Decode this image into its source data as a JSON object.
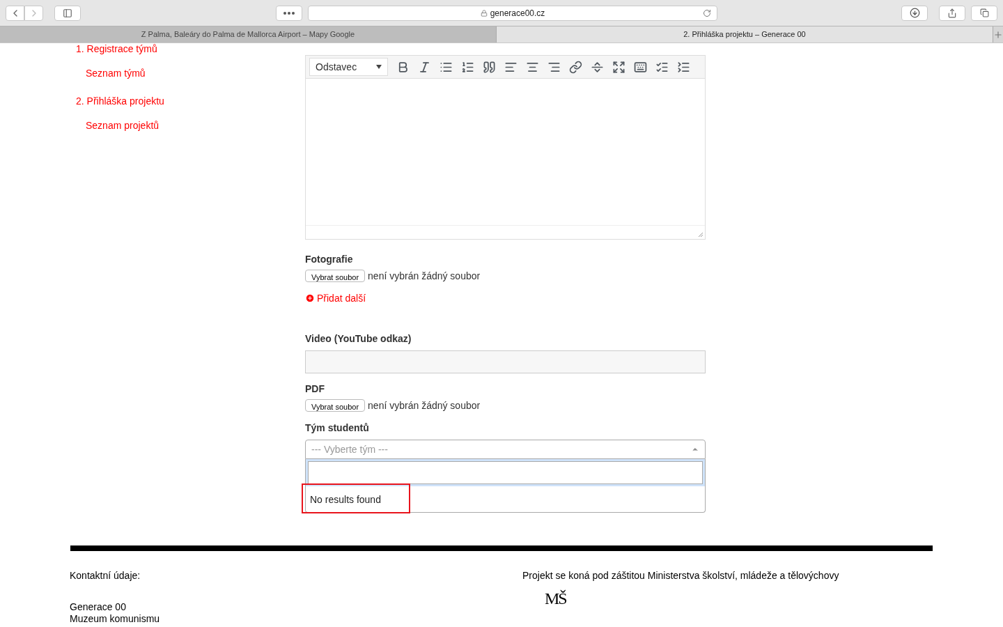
{
  "browser": {
    "url": "generace00.cz",
    "tabs": [
      {
        "title": "Z Palma, Baleáry do Palma de Mallorca Airport – Mapy Google",
        "selected": false
      },
      {
        "title": "2. Přihláška projektu – Generace 00",
        "selected": true
      }
    ]
  },
  "nav": [
    {
      "label": "1. Registrace týmů",
      "kind": "main"
    },
    {
      "label": "Seznam týmů",
      "kind": "sub"
    },
    {
      "label": "2. Přihláška projektu",
      "kind": "main"
    },
    {
      "label": "Seznam projektů",
      "kind": "sub"
    }
  ],
  "editor": {
    "format": "Odstavec"
  },
  "fields": [
    {
      "kind": "file",
      "label": "Fotografie",
      "button": "Vybrat soubor",
      "status": "není vybrán žádný soubor",
      "add": "Přidat další"
    },
    {
      "kind": "text",
      "label": "Video (YouTube odkaz)"
    },
    {
      "kind": "file",
      "label": "PDF",
      "button": "Vybrat soubor",
      "status": "není vybrán žádný soubor"
    },
    {
      "kind": "select",
      "label": "Tým studentů",
      "placeholder": "--- Vyberte tým ---",
      "expanded": true,
      "message": "No results found",
      "highlighted": true
    }
  ],
  "footer": {
    "contact_heading": "Kontaktní údaje:",
    "contact_lines": [
      "Generace 00",
      "Muzeum komunismu"
    ],
    "patronage": "Projekt se koná pod záštitou Ministerstva školství, mládeže a tělovýchovy",
    "logo": "MŠ"
  }
}
